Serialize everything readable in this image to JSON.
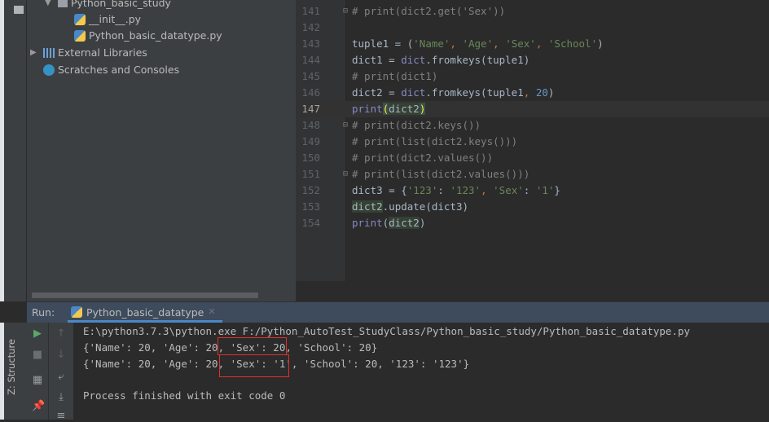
{
  "project_tree": {
    "folder": "Python_basic_study",
    "files": [
      "__init__.py",
      "Python_basic_datatype.py"
    ],
    "external_libraries": "External Libraries",
    "scratches": "Scratches and Consoles"
  },
  "editor": {
    "current_line": 147,
    "lines": [
      {
        "n": 141,
        "fold": true,
        "tokens": [
          [
            "# print(dict2.get('Sex'))",
            "cmt"
          ]
        ]
      },
      {
        "n": 142,
        "tokens": []
      },
      {
        "n": 143,
        "tokens": [
          [
            "tuple1 = (",
            ""
          ],
          [
            "'Name'",
            "str"
          ],
          [
            ", ",
            "punc"
          ],
          [
            "'Age'",
            "str"
          ],
          [
            ", ",
            "punc"
          ],
          [
            "'Sex'",
            "str"
          ],
          [
            ", ",
            "punc"
          ],
          [
            "'School'",
            "str"
          ],
          [
            ")",
            ""
          ]
        ]
      },
      {
        "n": 144,
        "tokens": [
          [
            "dict1 = ",
            ""
          ],
          [
            "dict",
            "bi"
          ],
          [
            ".fromkeys(tuple1)",
            ""
          ]
        ]
      },
      {
        "n": 145,
        "tokens": [
          [
            "# print(dict1)",
            "cmt"
          ]
        ]
      },
      {
        "n": 146,
        "tokens": [
          [
            "dict2 = ",
            ""
          ],
          [
            "dict",
            "bi"
          ],
          [
            ".fromkeys(tuple1",
            ""
          ],
          [
            ", ",
            "punc"
          ],
          [
            "20",
            "num"
          ],
          [
            ")",
            ""
          ]
        ]
      },
      {
        "n": 147,
        "tokens": [
          [
            "print",
            "bi"
          ],
          [
            "(",
            "br"
          ],
          [
            "dict2",
            "hl"
          ],
          [
            ")",
            "br"
          ]
        ]
      },
      {
        "n": 148,
        "fold": true,
        "tokens": [
          [
            "# print(dict2.keys())",
            "cmt"
          ]
        ]
      },
      {
        "n": 149,
        "tokens": [
          [
            "# print(list(dict2.keys()))",
            "cmt"
          ]
        ]
      },
      {
        "n": 150,
        "tokens": [
          [
            "# print(dict2.values())",
            "cmt"
          ]
        ]
      },
      {
        "n": 151,
        "fold": true,
        "tokens": [
          [
            "# print(list(dict2.values()))",
            "cmt"
          ]
        ]
      },
      {
        "n": 152,
        "tokens": [
          [
            "dict3 = {",
            ""
          ],
          [
            "'123'",
            "str"
          ],
          [
            ": ",
            ""
          ],
          [
            "'123'",
            "str"
          ],
          [
            ", ",
            "punc"
          ],
          [
            "'Sex'",
            "str"
          ],
          [
            ": ",
            ""
          ],
          [
            "'1'",
            "str"
          ],
          [
            "}",
            ""
          ]
        ]
      },
      {
        "n": 153,
        "tokens": [
          [
            "dict2",
            "hl"
          ],
          [
            ".update(dict3)",
            ""
          ]
        ]
      },
      {
        "n": 154,
        "tokens": [
          [
            "print",
            "bi"
          ],
          [
            "(",
            ""
          ],
          [
            "dict2",
            "hl"
          ],
          [
            ")",
            ""
          ]
        ]
      }
    ]
  },
  "run": {
    "label": "Run:",
    "tab": "Python_basic_datatype",
    "structure_label": "Z: Structure",
    "output": [
      "E:\\python3.7.3\\python.exe F:/Python_AutoTest_StudyClass/Python_basic_study/Python_basic_datatype.py",
      "{'Name': 20, 'Age': 20, 'Sex': 20, 'School': 20}",
      "{'Name': 20, 'Age': 20, 'Sex': '1', 'School': 20, '123': '123'}",
      "",
      "Process finished with exit code 0"
    ]
  },
  "colors": {
    "highlight_box": "#e03030",
    "accent": "#4a88c7"
  }
}
